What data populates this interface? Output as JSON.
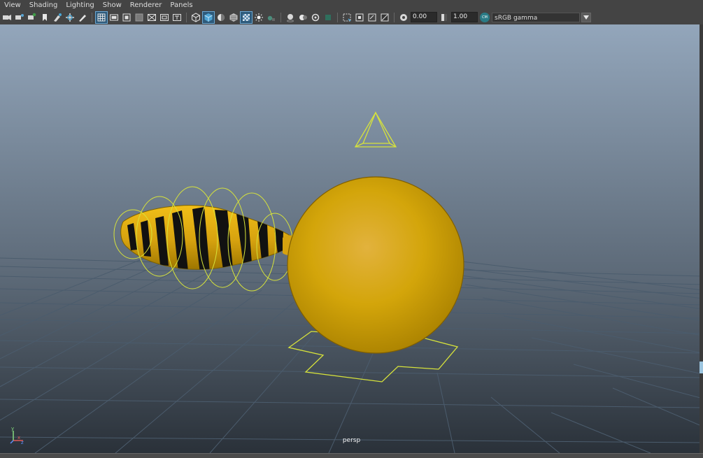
{
  "menubar": {
    "items": [
      "View",
      "Shading",
      "Lighting",
      "Show",
      "Renderer",
      "Panels"
    ]
  },
  "toolbar": {
    "exposure_value": "0.00",
    "gamma_value": "1.00",
    "color_management_badge": "CM",
    "color_space": "sRGB gamma",
    "icons": [
      "camera-icon",
      "camera-attributes-icon",
      "bookmark-icon",
      "image-plane-icon",
      "2d-pan-zoom-icon",
      "grease-pencil-icon",
      "grid-icon",
      "film-gate-icon",
      "resolution-gate-icon",
      "gate-mask-icon",
      "field-chart-icon",
      "safe-action-icon",
      "safe-title-icon",
      "wireframe-icon",
      "smooth-shade-icon",
      "default-material-icon",
      "textured-icon",
      "use-all-lights-icon",
      "shadows-icon",
      "screen-space-ao-icon",
      "motion-blur-icon",
      "multisample-aa-icon",
      "depth-of-field-icon",
      "isolate-select-icon",
      "xray-icon",
      "xray-joints-icon",
      "xray-components-icon",
      "backface-culling-icon",
      "exposure-icon",
      "gamma-icon",
      "color-management-icon",
      "dropdown-arrow-icon"
    ]
  },
  "viewport": {
    "camera_name": "persp",
    "axis": {
      "y_label": "y",
      "x_label": "x",
      "z_label": "z"
    },
    "colors": {
      "background_top": "#8ea1b6",
      "background_bottom": "#2a3139",
      "grid_line": "#4b5c6d",
      "wire_selection": "#d7e33b",
      "sphere_base": "#d4a40a",
      "stripe": "#111111"
    }
  },
  "status": {
    "right_scroll_color": "#9cc5df"
  }
}
